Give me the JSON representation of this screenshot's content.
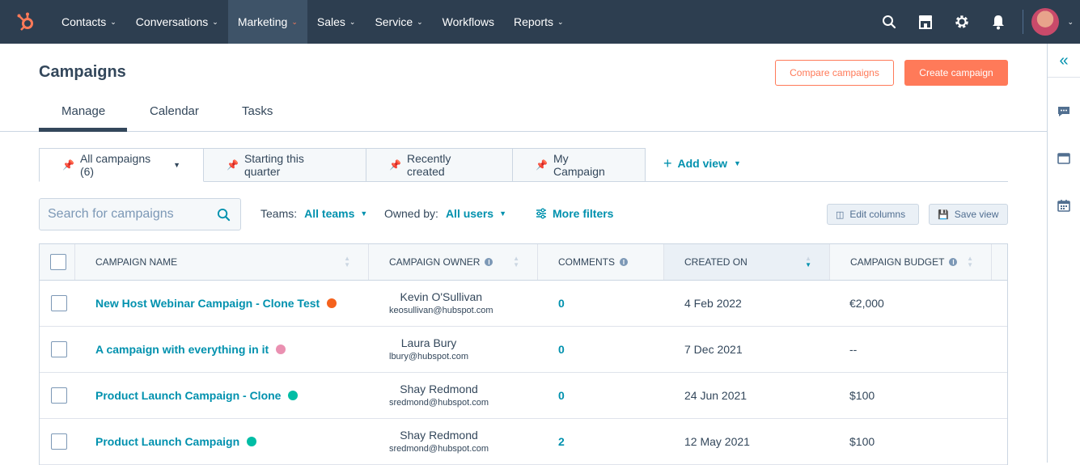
{
  "topnav": {
    "items": [
      {
        "label": "Contacts"
      },
      {
        "label": "Conversations"
      },
      {
        "label": "Marketing"
      },
      {
        "label": "Sales"
      },
      {
        "label": "Service"
      },
      {
        "label": "Workflows"
      },
      {
        "label": "Reports"
      }
    ],
    "active": "Marketing",
    "accent": "#ff7a59",
    "bg": "#2d3e50"
  },
  "page": {
    "title": "Campaigns",
    "compare_label": "Compare campaigns",
    "create_label": "Create campaign"
  },
  "tabs": [
    {
      "label": "Manage"
    },
    {
      "label": "Calendar"
    },
    {
      "label": "Tasks"
    }
  ],
  "views": [
    {
      "label": "All campaigns (6)"
    },
    {
      "label": "Starting this quarter"
    },
    {
      "label": "Recently created"
    },
    {
      "label": "My Campaign"
    }
  ],
  "add_view_label": "Add view",
  "filters": {
    "search_placeholder": "Search for campaigns",
    "teams_label": "Teams:",
    "teams_value": "All teams",
    "owned_label": "Owned by:",
    "owned_value": "All users",
    "more_filters_label": "More filters",
    "edit_columns_label": "Edit columns",
    "save_view_label": "Save view"
  },
  "table": {
    "columns": [
      "Campaign Name",
      "Campaign Owner",
      "Comments",
      "Created On",
      "Campaign Budget"
    ],
    "rows": [
      {
        "name": "New Host Webinar Campaign - Clone Test",
        "color": "#f5621d",
        "owner": "Kevin O'Sullivan",
        "email": "keosullivan@hubspot.com",
        "comments": "0",
        "created": "4 Feb 2022",
        "budget": "€2,000"
      },
      {
        "name": "A campaign with everything in it",
        "color": "#ea90b1",
        "owner": "Laura Bury",
        "email": "lbury@hubspot.com",
        "comments": "0",
        "created": "7 Dec 2021",
        "budget": "--"
      },
      {
        "name": "Product Launch Campaign - Clone",
        "color": "#00bda5",
        "owner": "Shay Redmond",
        "email": "sredmond@hubspot.com",
        "comments": "0",
        "created": "24 Jun 2021",
        "budget": "$100"
      },
      {
        "name": "Product Launch Campaign",
        "color": "#00bda5",
        "owner": "Shay Redmond",
        "email": "sredmond@hubspot.com",
        "comments": "2",
        "created": "12 May 2021",
        "budget": "$100"
      }
    ]
  }
}
